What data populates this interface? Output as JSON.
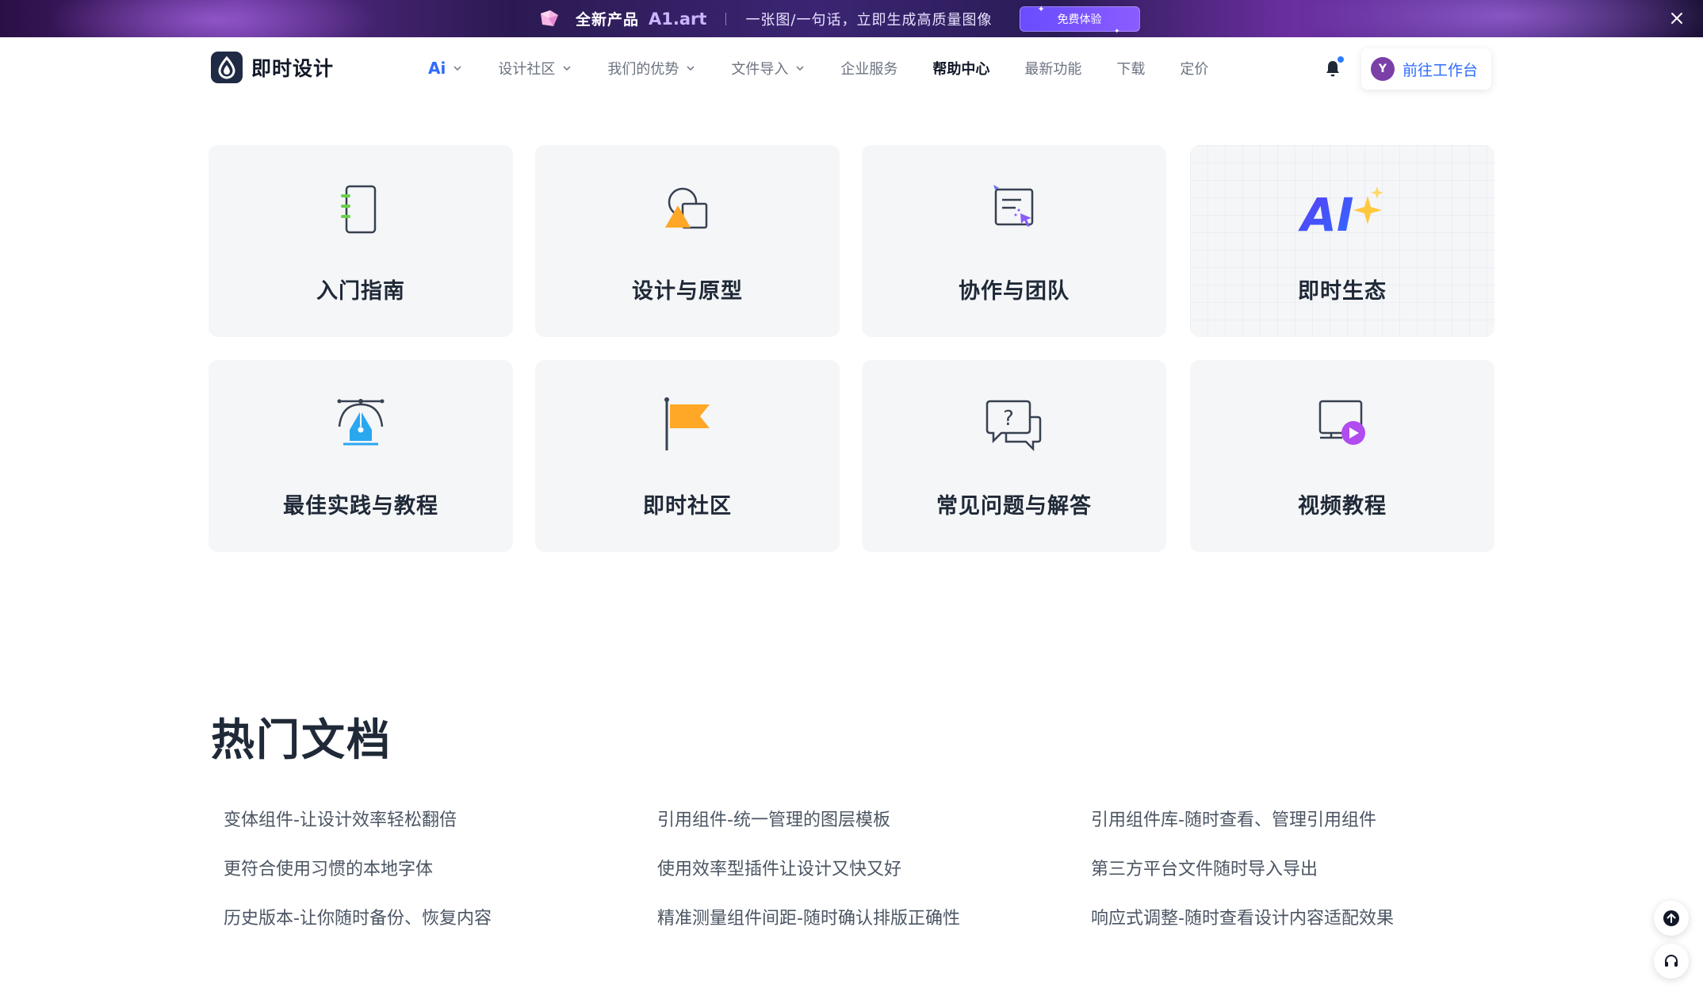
{
  "promo": {
    "headline": "全新产品",
    "brand": "A1.art",
    "tagline": "一张图/一句话，立即生成高质量图像",
    "button": "免费体验"
  },
  "header": {
    "logo_text": "即时设计",
    "nav": [
      {
        "label": "Ai",
        "has_dropdown": true
      },
      {
        "label": "设计社区",
        "has_dropdown": true
      },
      {
        "label": "我们的优势",
        "has_dropdown": true
      },
      {
        "label": "文件导入",
        "has_dropdown": true
      },
      {
        "label": "企业服务",
        "has_dropdown": false
      },
      {
        "label": "帮助中心",
        "has_dropdown": false,
        "active": true
      },
      {
        "label": "最新功能",
        "has_dropdown": false
      },
      {
        "label": "下载",
        "has_dropdown": false
      },
      {
        "label": "定价",
        "has_dropdown": false
      }
    ],
    "avatar_initial": "Y",
    "workbench_label": "前往工作台"
  },
  "categories": [
    {
      "label": "入门指南",
      "icon": "notebook-icon"
    },
    {
      "label": "设计与原型",
      "icon": "shapes-icon"
    },
    {
      "label": "协作与团队",
      "icon": "collaboration-cursor-icon"
    },
    {
      "label": "即时生态",
      "icon": "ai-sparkle-icon",
      "icon_text": "AI"
    },
    {
      "label": "最佳实践与教程",
      "icon": "pen-tool-icon"
    },
    {
      "label": "即时社区",
      "icon": "flag-icon"
    },
    {
      "label": "常见问题与解答",
      "icon": "question-chat-icon"
    },
    {
      "label": "视频教程",
      "icon": "video-play-icon"
    }
  ],
  "hot_docs": {
    "title": "热门文档",
    "items": [
      "变体组件-让设计效率轻松翻倍",
      "引用组件-统一管理的图层模板",
      "引用组件库-随时查看、管理引用组件",
      "更符合使用习惯的本地字体",
      "使用效率型插件让设计又快又好",
      "第三方平台文件随时导入导出",
      "历史版本-让你随时备份、恢复内容",
      "精准测量组件间距-随时确认排版正确性",
      "响应式调整-随时查看设计内容适配效果"
    ]
  },
  "colors": {
    "accent": "#2f6bff",
    "card_bg": "#f5f6f8",
    "promo_button": "#7a55ff",
    "flag": "#ffa726",
    "pen": "#29a8f0",
    "play": "#b04cf0"
  }
}
